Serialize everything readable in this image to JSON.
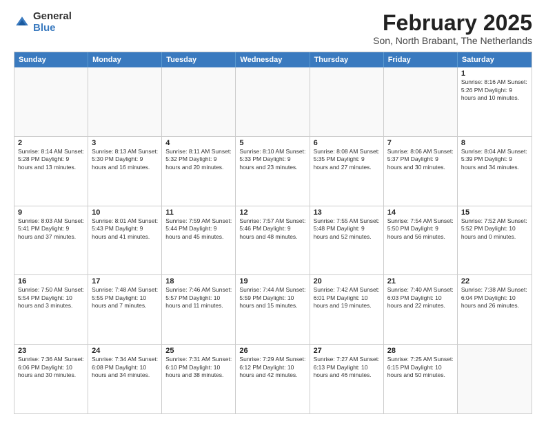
{
  "logo": {
    "general": "General",
    "blue": "Blue"
  },
  "header": {
    "month": "February 2025",
    "location": "Son, North Brabant, The Netherlands"
  },
  "days_of_week": [
    "Sunday",
    "Monday",
    "Tuesday",
    "Wednesday",
    "Thursday",
    "Friday",
    "Saturday"
  ],
  "weeks": [
    [
      {
        "day": "",
        "info": ""
      },
      {
        "day": "",
        "info": ""
      },
      {
        "day": "",
        "info": ""
      },
      {
        "day": "",
        "info": ""
      },
      {
        "day": "",
        "info": ""
      },
      {
        "day": "",
        "info": ""
      },
      {
        "day": "1",
        "info": "Sunrise: 8:16 AM\nSunset: 5:26 PM\nDaylight: 9 hours and 10 minutes."
      }
    ],
    [
      {
        "day": "2",
        "info": "Sunrise: 8:14 AM\nSunset: 5:28 PM\nDaylight: 9 hours and 13 minutes."
      },
      {
        "day": "3",
        "info": "Sunrise: 8:13 AM\nSunset: 5:30 PM\nDaylight: 9 hours and 16 minutes."
      },
      {
        "day": "4",
        "info": "Sunrise: 8:11 AM\nSunset: 5:32 PM\nDaylight: 9 hours and 20 minutes."
      },
      {
        "day": "5",
        "info": "Sunrise: 8:10 AM\nSunset: 5:33 PM\nDaylight: 9 hours and 23 minutes."
      },
      {
        "day": "6",
        "info": "Sunrise: 8:08 AM\nSunset: 5:35 PM\nDaylight: 9 hours and 27 minutes."
      },
      {
        "day": "7",
        "info": "Sunrise: 8:06 AM\nSunset: 5:37 PM\nDaylight: 9 hours and 30 minutes."
      },
      {
        "day": "8",
        "info": "Sunrise: 8:04 AM\nSunset: 5:39 PM\nDaylight: 9 hours and 34 minutes."
      }
    ],
    [
      {
        "day": "9",
        "info": "Sunrise: 8:03 AM\nSunset: 5:41 PM\nDaylight: 9 hours and 37 minutes."
      },
      {
        "day": "10",
        "info": "Sunrise: 8:01 AM\nSunset: 5:43 PM\nDaylight: 9 hours and 41 minutes."
      },
      {
        "day": "11",
        "info": "Sunrise: 7:59 AM\nSunset: 5:44 PM\nDaylight: 9 hours and 45 minutes."
      },
      {
        "day": "12",
        "info": "Sunrise: 7:57 AM\nSunset: 5:46 PM\nDaylight: 9 hours and 48 minutes."
      },
      {
        "day": "13",
        "info": "Sunrise: 7:55 AM\nSunset: 5:48 PM\nDaylight: 9 hours and 52 minutes."
      },
      {
        "day": "14",
        "info": "Sunrise: 7:54 AM\nSunset: 5:50 PM\nDaylight: 9 hours and 56 minutes."
      },
      {
        "day": "15",
        "info": "Sunrise: 7:52 AM\nSunset: 5:52 PM\nDaylight: 10 hours and 0 minutes."
      }
    ],
    [
      {
        "day": "16",
        "info": "Sunrise: 7:50 AM\nSunset: 5:54 PM\nDaylight: 10 hours and 3 minutes."
      },
      {
        "day": "17",
        "info": "Sunrise: 7:48 AM\nSunset: 5:55 PM\nDaylight: 10 hours and 7 minutes."
      },
      {
        "day": "18",
        "info": "Sunrise: 7:46 AM\nSunset: 5:57 PM\nDaylight: 10 hours and 11 minutes."
      },
      {
        "day": "19",
        "info": "Sunrise: 7:44 AM\nSunset: 5:59 PM\nDaylight: 10 hours and 15 minutes."
      },
      {
        "day": "20",
        "info": "Sunrise: 7:42 AM\nSunset: 6:01 PM\nDaylight: 10 hours and 19 minutes."
      },
      {
        "day": "21",
        "info": "Sunrise: 7:40 AM\nSunset: 6:03 PM\nDaylight: 10 hours and 22 minutes."
      },
      {
        "day": "22",
        "info": "Sunrise: 7:38 AM\nSunset: 6:04 PM\nDaylight: 10 hours and 26 minutes."
      }
    ],
    [
      {
        "day": "23",
        "info": "Sunrise: 7:36 AM\nSunset: 6:06 PM\nDaylight: 10 hours and 30 minutes."
      },
      {
        "day": "24",
        "info": "Sunrise: 7:34 AM\nSunset: 6:08 PM\nDaylight: 10 hours and 34 minutes."
      },
      {
        "day": "25",
        "info": "Sunrise: 7:31 AM\nSunset: 6:10 PM\nDaylight: 10 hours and 38 minutes."
      },
      {
        "day": "26",
        "info": "Sunrise: 7:29 AM\nSunset: 6:12 PM\nDaylight: 10 hours and 42 minutes."
      },
      {
        "day": "27",
        "info": "Sunrise: 7:27 AM\nSunset: 6:13 PM\nDaylight: 10 hours and 46 minutes."
      },
      {
        "day": "28",
        "info": "Sunrise: 7:25 AM\nSunset: 6:15 PM\nDaylight: 10 hours and 50 minutes."
      },
      {
        "day": "",
        "info": ""
      }
    ]
  ]
}
